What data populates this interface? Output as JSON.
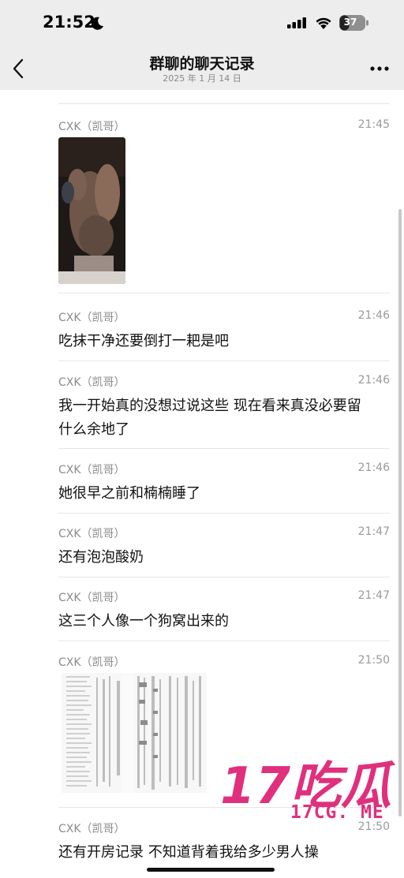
{
  "status_bar": {
    "time": "21:52",
    "battery": "37"
  },
  "nav": {
    "title": "群聊的聊天记录",
    "subtitle": "2025 年 1 月 14 日"
  },
  "messages": [
    {
      "sender": "CXK（凯哥）",
      "time": "21:45",
      "kind": "video"
    },
    {
      "sender": "CXK（凯哥）",
      "time": "21:46",
      "text": "吃抹干净还要倒打一耙是吧"
    },
    {
      "sender": "CXK（凯哥）",
      "time": "21:46",
      "text": "我一开始真的没想过说这些 现在看来真没必要留\n什么余地了"
    },
    {
      "sender": "CXK（凯哥）",
      "time": "21:46",
      "text": "她很早之前和楠楠睡了"
    },
    {
      "sender": "CXK（凯哥）",
      "time": "21:47",
      "text": "还有泡泡酸奶"
    },
    {
      "sender": "CXK（凯哥）",
      "time": "21:47",
      "text": "这三个人像一个狗窝出来的"
    },
    {
      "sender": "CXK（凯哥）",
      "time": "21:50",
      "kind": "image"
    },
    {
      "sender": "CXK（凯哥）",
      "time": "21:50",
      "text": "还有开房记录 不知道背着我给多少男人操"
    }
  ],
  "watermark": {
    "logo_text": "17吃瓜",
    "domain": "17CG. ME"
  },
  "colors": {
    "header_bg": "#ededed",
    "watermark": "#e0307d"
  }
}
